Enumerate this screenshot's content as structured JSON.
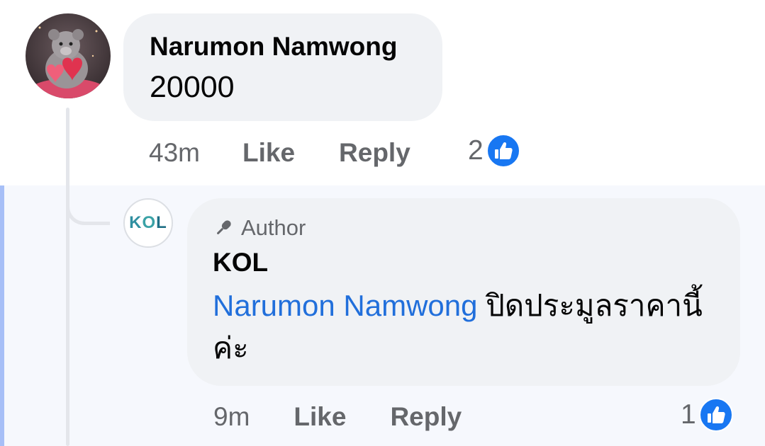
{
  "comment": {
    "author": "Narumon Namwong",
    "text": "20000",
    "time": "43m",
    "like_label": "Like",
    "reply_label": "Reply",
    "reaction_count": "2",
    "reaction_icon": "like-icon"
  },
  "reply": {
    "badge_label": "Author",
    "badge_icon": "microphone-icon",
    "avatar_logo_text": "KOL",
    "author": "KOL",
    "mention": "Narumon Namwong",
    "text": "ปิดประมูลราคานี้ค่ะ",
    "time": "9m",
    "like_label": "Like",
    "reply_label": "Reply",
    "reaction_count": "1",
    "reaction_icon": "like-icon"
  },
  "colors": {
    "bubble": "#f0f2f5",
    "mention": "#216fdb",
    "like_blue": "#1877f2",
    "meta_gray": "#65676b",
    "highlight_bg": "#f6f8fd",
    "highlight_bar": "#a7bff7"
  }
}
